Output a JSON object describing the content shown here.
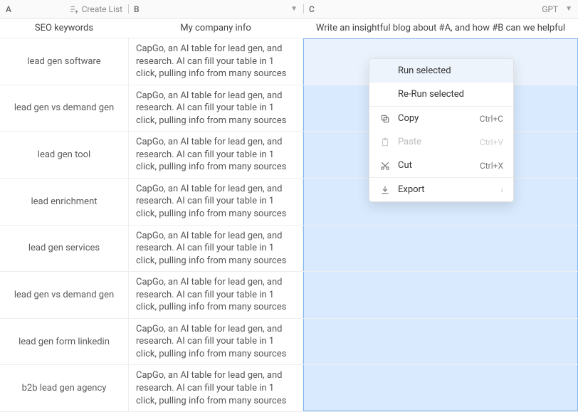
{
  "header": {
    "colA_letter": "A",
    "colA_action": "Create List",
    "colB_letter": "B",
    "colC_letter": "C",
    "gpt_label": "GPT"
  },
  "titles": {
    "colA": "SEO keywords",
    "colB": "My company info",
    "colC": "Write an insightful blog about #A, and how #B can we helpful"
  },
  "company_info_text": "CapGo, an AI table for lead gen, and research. AI can fill your table in 1 click, pulling info from many sources",
  "rows": [
    {
      "keyword": "lead gen software"
    },
    {
      "keyword": "lead gen vs demand gen"
    },
    {
      "keyword": "lead gen tool"
    },
    {
      "keyword": "lead enrichment"
    },
    {
      "keyword": "lead gen services"
    },
    {
      "keyword": "lead gen vs demand gen"
    },
    {
      "keyword": "lead gen form linkedin"
    },
    {
      "keyword": "b2b lead gen agency"
    }
  ],
  "context_menu": {
    "run_selected": "Run selected",
    "rerun_selected": "Re-Run selected",
    "copy_label": "Copy",
    "copy_shortcut": "Ctrl+C",
    "paste_label": "Paste",
    "paste_shortcut": "Ctrl+V",
    "cut_label": "Cut",
    "cut_shortcut": "Ctrl+X",
    "export_label": "Export"
  }
}
